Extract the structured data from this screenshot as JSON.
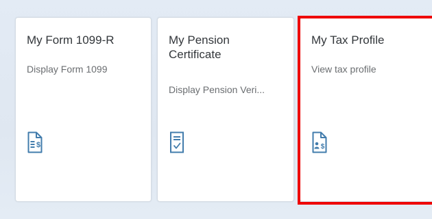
{
  "tiles": [
    {
      "title": "My Form 1099-R",
      "subtitle": "Display Form 1099",
      "icon": "tax-form-dollar-icon"
    },
    {
      "title": "My Pension Certificate",
      "subtitle": "Display Pension Veri...",
      "icon": "certificate-check-icon"
    },
    {
      "title": "My Tax Profile",
      "subtitle": "View tax profile",
      "icon": "tax-profile-person-dollar-icon"
    }
  ],
  "colors": {
    "icon_blue": "#427cac",
    "highlight_red": "#ee0000",
    "title_text": "#32363a",
    "subtitle_text": "#6a6d70"
  }
}
